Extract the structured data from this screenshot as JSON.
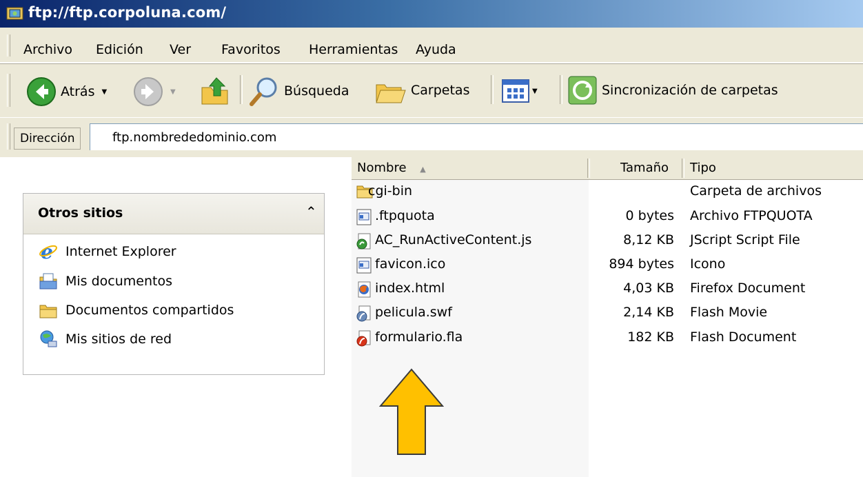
{
  "window": {
    "title": "ftp://ftp.corpoluna.com/",
    "accent_color": "#0a246a",
    "icon": "ftp-folder-icon"
  },
  "menu": {
    "items": [
      {
        "label": "Archivo"
      },
      {
        "label": "Edición"
      },
      {
        "label": "Ver"
      },
      {
        "label": "Favoritos"
      },
      {
        "label": "Herramientas"
      },
      {
        "label": "Ayuda"
      }
    ]
  },
  "toolbar": {
    "back_label": "Atrás",
    "search_label": "Búsqueda",
    "folders_label": "Carpetas",
    "sync_label": "Sincronización de carpetas"
  },
  "address": {
    "label": "Dirección",
    "value": "ftp.nombrededominio.com"
  },
  "tasks": {
    "title": "Otros sitios",
    "items": [
      {
        "label": "Internet Explorer",
        "icon": "internet-explorer-icon"
      },
      {
        "label": "Mis documentos",
        "icon": "my-documents-icon"
      },
      {
        "label": "Documentos compartidos",
        "icon": "shared-folder-icon"
      },
      {
        "label": "Mis sitios de red",
        "icon": "network-places-icon"
      }
    ]
  },
  "files": {
    "columns": {
      "name": "Nombre",
      "size": "Tamaño",
      "type": "Tipo"
    },
    "rows": [
      {
        "name": "cgi-bin",
        "size": "",
        "type": "Carpeta de archivos",
        "icon": "folder-icon"
      },
      {
        "name": ".ftpquota",
        "size": "0 bytes",
        "type": "Archivo FTPQUOTA",
        "icon": "generic-file-icon"
      },
      {
        "name": "AC_RunActiveContent.js",
        "size": "8,12 KB",
        "type": "JScript Script File",
        "icon": "jscript-file-icon"
      },
      {
        "name": "favicon.ico",
        "size": "894 bytes",
        "type": "Icono",
        "icon": "generic-file-icon"
      },
      {
        "name": "index.html",
        "size": "4,03 KB",
        "type": "Firefox Document",
        "icon": "firefox-document-icon"
      },
      {
        "name": "pelicula.swf",
        "size": "2,14 KB",
        "type": "Flash Movie",
        "icon": "flash-movie-icon"
      },
      {
        "name": "formulario.fla",
        "size": "182 KB",
        "type": "Flash Document",
        "icon": "flash-document-icon"
      }
    ]
  },
  "annotation": {
    "arrow_color": "#ffc000",
    "icon": "up-arrow-annotation"
  }
}
